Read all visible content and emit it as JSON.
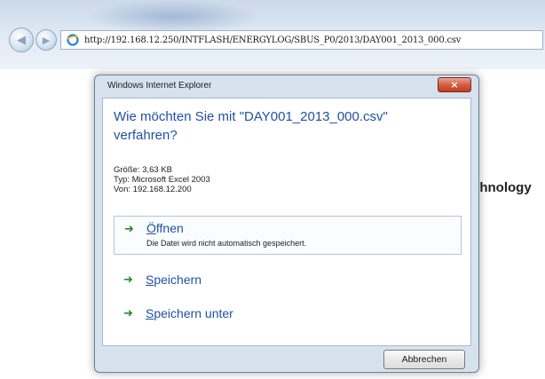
{
  "browser": {
    "url": "http://192.168.12.250/INTFLASH/ENERGYLOG/SBUS_P0/2013/DAY001_2013_000.csv",
    "back_icon": "back-arrow-icon",
    "forward_icon": "forward-arrow-icon",
    "page_icon": "ie-page-icon",
    "page_text_fragment": "chnology"
  },
  "dialog": {
    "title": "Windows Internet Explorer",
    "close_label": "×",
    "question_line1": "Wie möchten Sie mit \"DAY001_2013_000.csv\"",
    "question_line2": "verfahren?",
    "size_line": "Größe: 3,63 KB",
    "type_line": "Typ: Microsoft Excel 2003",
    "from_line": "Von: 192.168.12.200",
    "options": [
      {
        "label_first": "Ö",
        "label_rest": "ffnen",
        "desc": "Die Datei wird nicht automatisch gespeichert."
      },
      {
        "label_first": "S",
        "label_rest": "peichern"
      },
      {
        "label_first": "S",
        "label_rest": "peichern unter"
      }
    ],
    "option_icon": "green-arrow-icon",
    "cancel_label": "Abbrechen"
  },
  "colors": {
    "accent": "#1f51a6",
    "arrow_green": "#1e8f2a",
    "close_red": "#c2401f"
  }
}
